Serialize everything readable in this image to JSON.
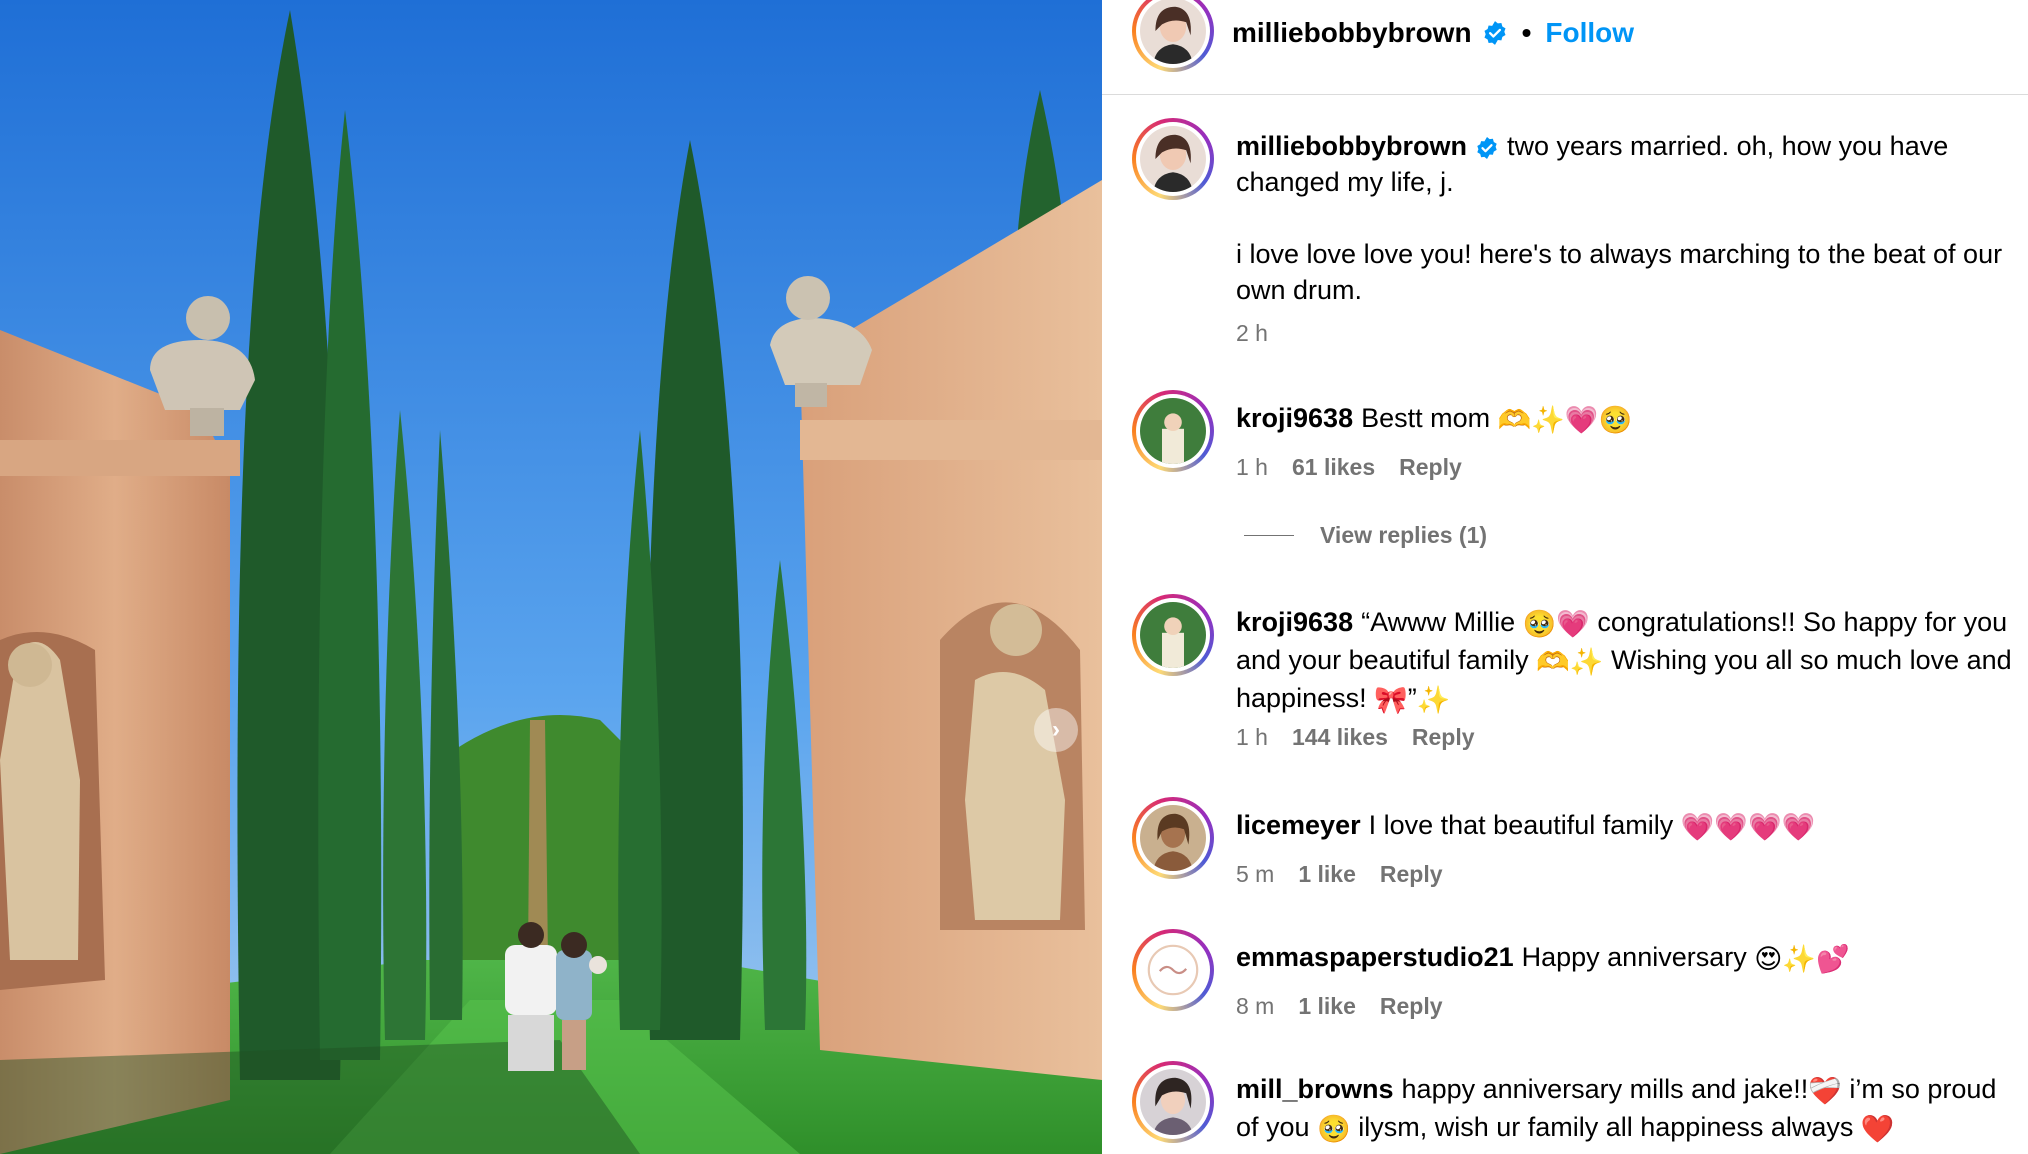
{
  "post": {
    "username": "milliebobbybrown",
    "verified": true,
    "follow_label": "Follow",
    "separator": "•",
    "caption_line1": "two years married. oh, how you have changed my life, j.",
    "caption_line2": "i love love love you! here's to always marching to the beat of our own drum.",
    "time": "2 h"
  },
  "comments": [
    {
      "username": "kroji9638",
      "text": "Bestt mom",
      "emojis": [
        "hand-heart-icon",
        "sparkles-icon",
        "pink-heart-icon",
        "pleading-face-icon"
      ],
      "time": "1 h",
      "likes": "61 likes",
      "reply": "Reply"
    },
    {
      "username": "kroji9638",
      "text_a": "“Awww Millie",
      "text_b": "congratulations!! So happy for you and your beautiful family",
      "text_c": "Wishing you all so much love and happiness!",
      "text_d": "”",
      "time": "1 h",
      "likes": "144 likes",
      "reply": "Reply"
    },
    {
      "username": "licemeyer",
      "text": "I love that beautiful family",
      "time": "5 m",
      "likes": "1 like",
      "reply": "Reply"
    },
    {
      "username": "emmaspaperstudio21",
      "text": "Happy anniversary",
      "time": "8 m",
      "likes": "1 like",
      "reply": "Reply"
    },
    {
      "username": "mill_browns",
      "text_a": "happy anniversary mills and jake!!",
      "text_b": "i’m so proud of you",
      "text_c": "ilysm, wish ur family all happiness always"
    }
  ],
  "view_replies_label": "View replies (1)",
  "carousel_next": "›",
  "colors": {
    "link_blue": "#0095f6",
    "meta_gray": "#737373",
    "border": "#dbdbdb",
    "sky": "#3b8fe6",
    "grass": "#3fa83a"
  }
}
